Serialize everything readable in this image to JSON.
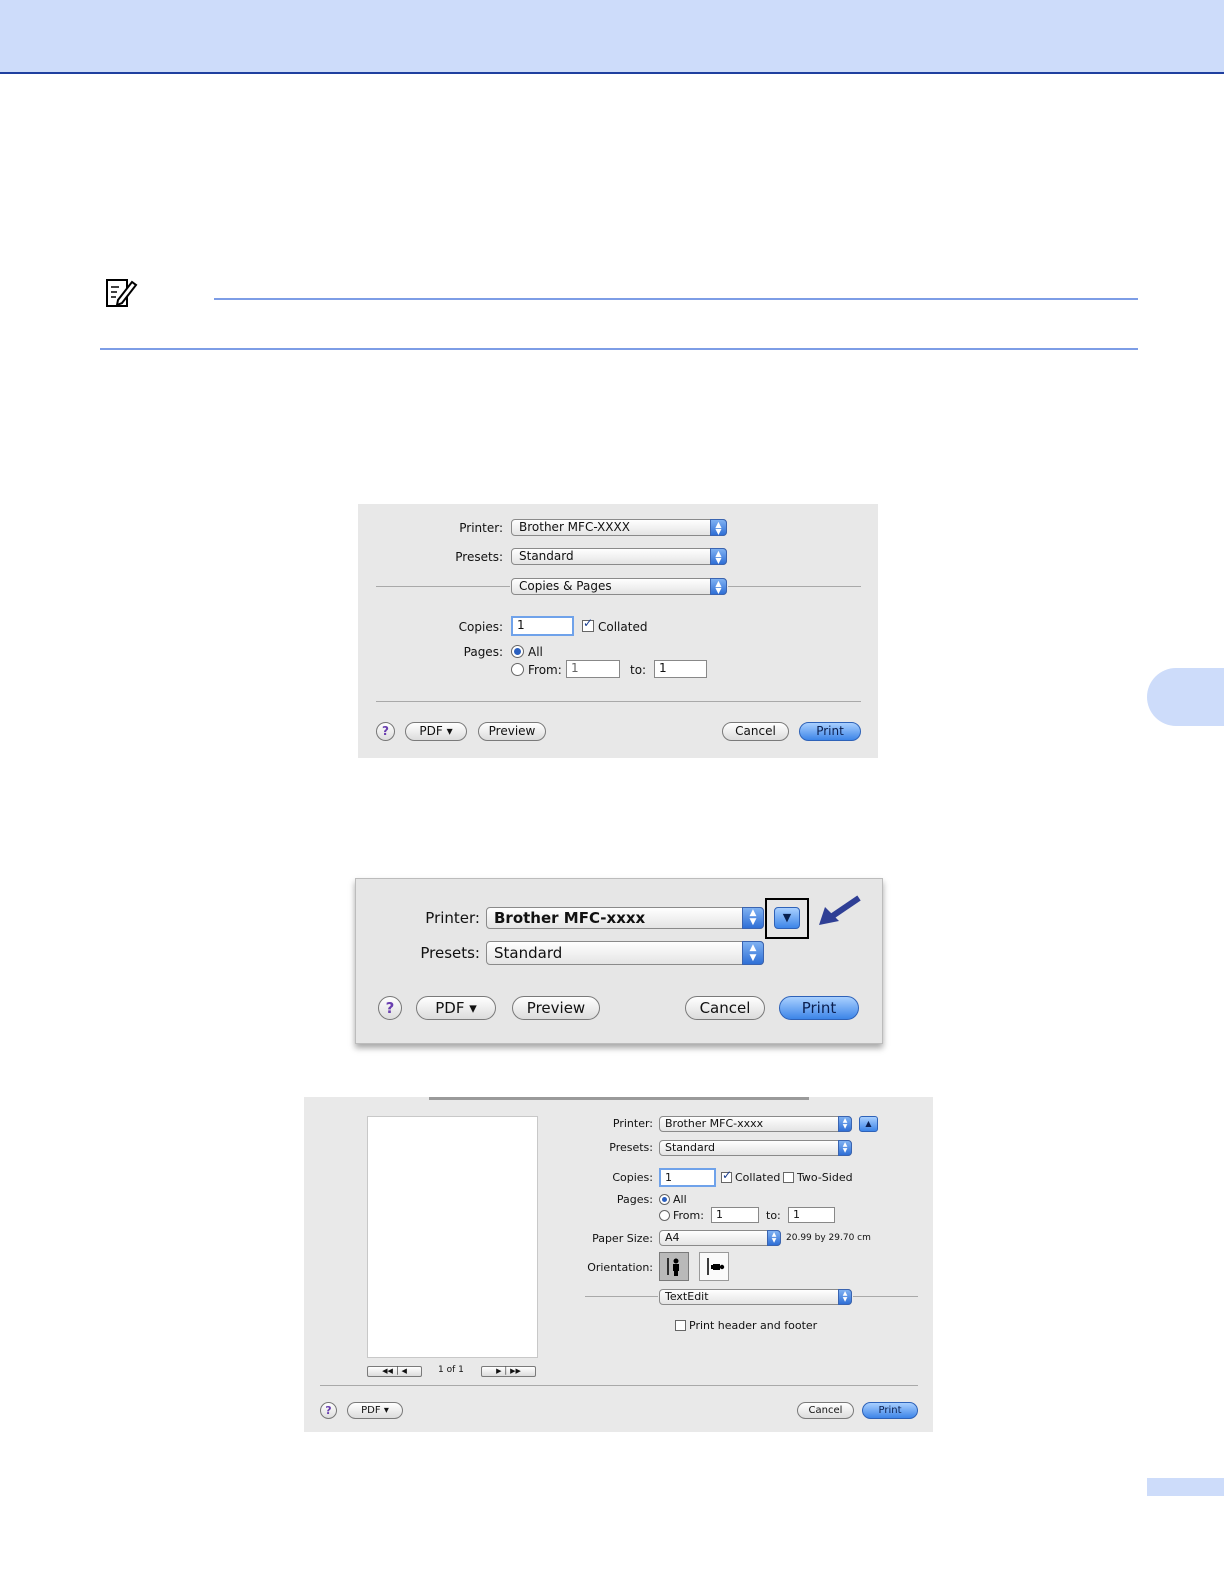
{
  "dialog1": {
    "printer_label": "Printer:",
    "printer_value": "Brother MFC-XXXX",
    "presets_label": "Presets:",
    "presets_value": "Standard",
    "section_value": "Copies & Pages",
    "copies_label": "Copies:",
    "copies_value": "1",
    "collated_label": "Collated",
    "pages_label": "Pages:",
    "all_label": "All",
    "from_label": "From:",
    "from_value": "1",
    "to_label": "to:",
    "to_value": "1",
    "help_label": "?",
    "pdf_label": "PDF ▾",
    "preview_label": "Preview",
    "cancel_label": "Cancel",
    "print_label": "Print"
  },
  "dialog2": {
    "printer_label": "Printer:",
    "printer_value": "Brother MFC-xxxx",
    "presets_label": "Presets:",
    "presets_value": "Standard",
    "help_label": "?",
    "pdf_label": "PDF ▾",
    "preview_label": "Preview",
    "cancel_label": "Cancel",
    "print_label": "Print"
  },
  "dialog3": {
    "printer_label": "Printer:",
    "printer_value": "Brother MFC-xxxx",
    "presets_label": "Presets:",
    "presets_value": "Standard",
    "copies_label": "Copies:",
    "copies_value": "1",
    "collated_label": "Collated",
    "two_sided_label": "Two-Sided",
    "pages_label": "Pages:",
    "all_label": "All",
    "from_label": "From:",
    "from_value": "1",
    "to_label": "to:",
    "to_value": "1",
    "paper_size_label": "Paper Size:",
    "paper_size_value": "A4",
    "paper_dimensions": "20.99 by 29.70 cm",
    "orientation_label": "Orientation:",
    "section_value": "TextEdit",
    "header_footer_label": "Print header and footer",
    "page_counter": "1 of 1",
    "help_label": "?",
    "pdf_label": "PDF ▾",
    "cancel_label": "Cancel",
    "print_label": "Print"
  }
}
